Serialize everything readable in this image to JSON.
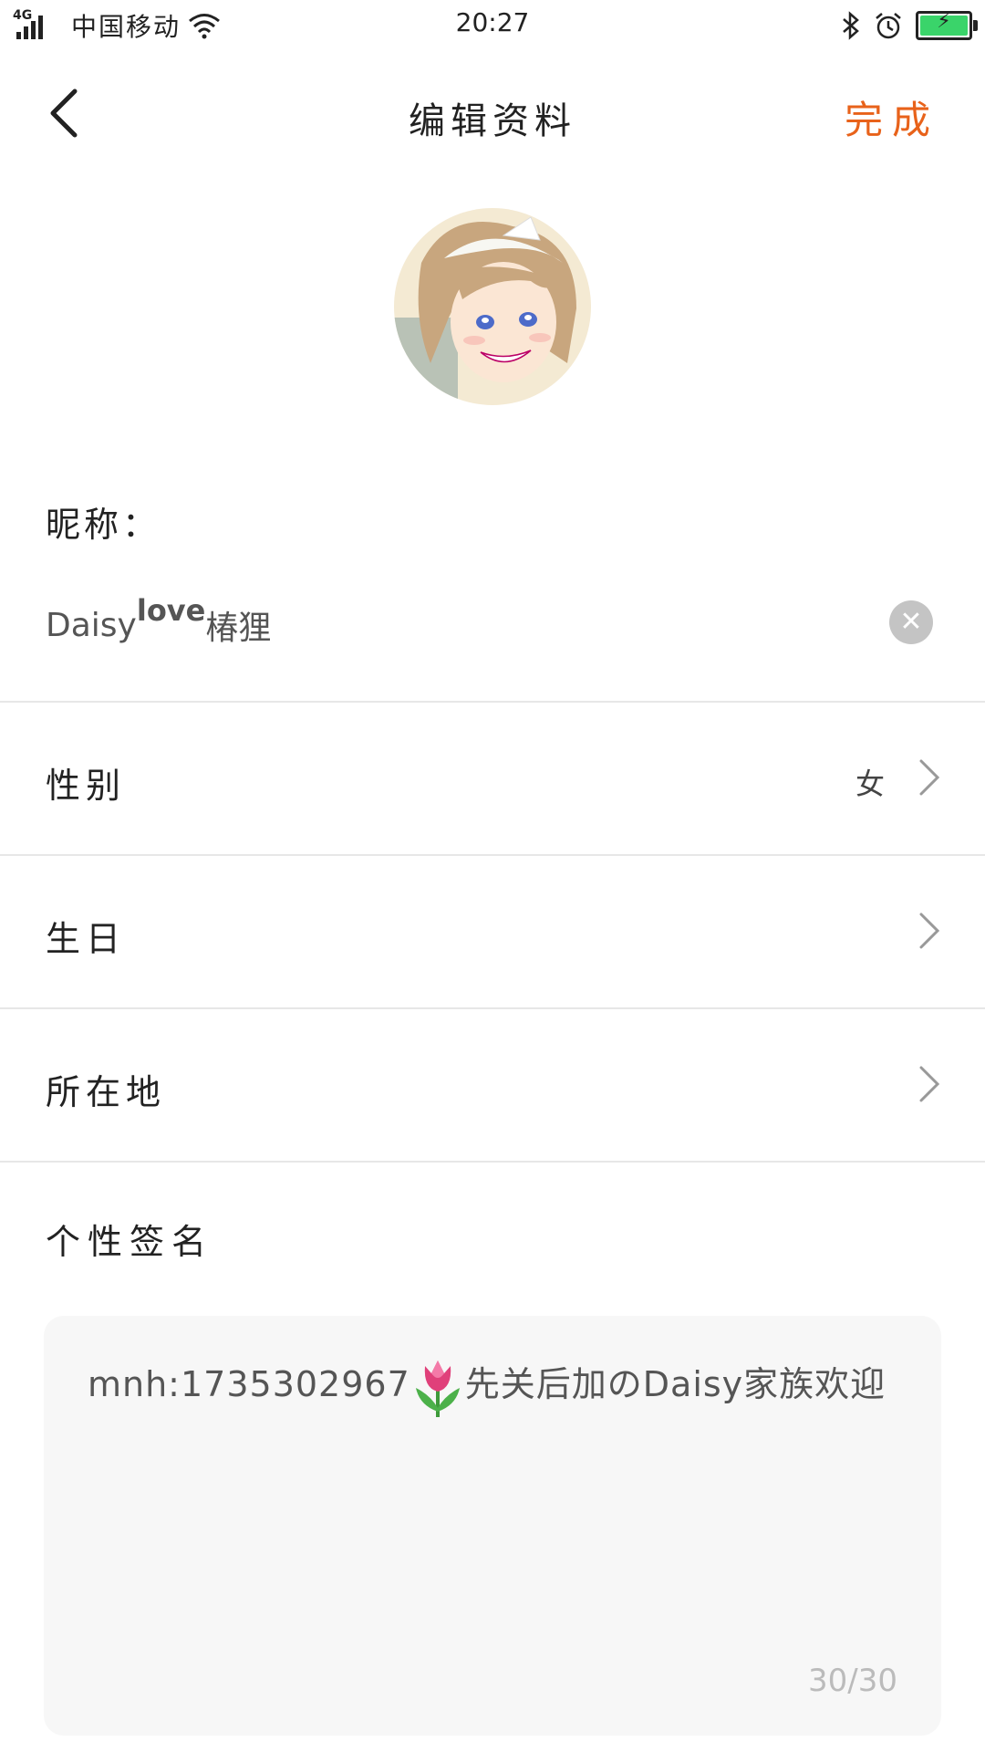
{
  "status_bar": {
    "network": "4G",
    "carrier": "中国移动",
    "time": "20:27"
  },
  "header": {
    "title": "编辑资料",
    "done_label": "完成"
  },
  "nickname": {
    "label": "昵称：",
    "value_prefix": "Daisy",
    "value_sup": "love",
    "value_suffix": "椿狸"
  },
  "rows": [
    {
      "label": "性别",
      "value": "女"
    },
    {
      "label": "生日",
      "value": ""
    },
    {
      "label": "所在地",
      "value": ""
    }
  ],
  "signature": {
    "label": "个性签名",
    "text_before": "mnh:1735302967",
    "text_after": "先关后加のDaisy家族欢迎",
    "counter": "30/30"
  },
  "icons": {
    "back": "back-arrow-icon",
    "clear": "clear-icon",
    "chevron": "chevron-right-icon",
    "bluetooth": "bluetooth-icon",
    "alarm": "alarm-icon",
    "wifi": "wifi-icon",
    "battery": "battery-charging-icon",
    "emoji": "tulip-emoji"
  },
  "colors": {
    "accent": "#e8621a",
    "battery": "#3ad46a",
    "signature_bg": "#f7f7f7"
  }
}
